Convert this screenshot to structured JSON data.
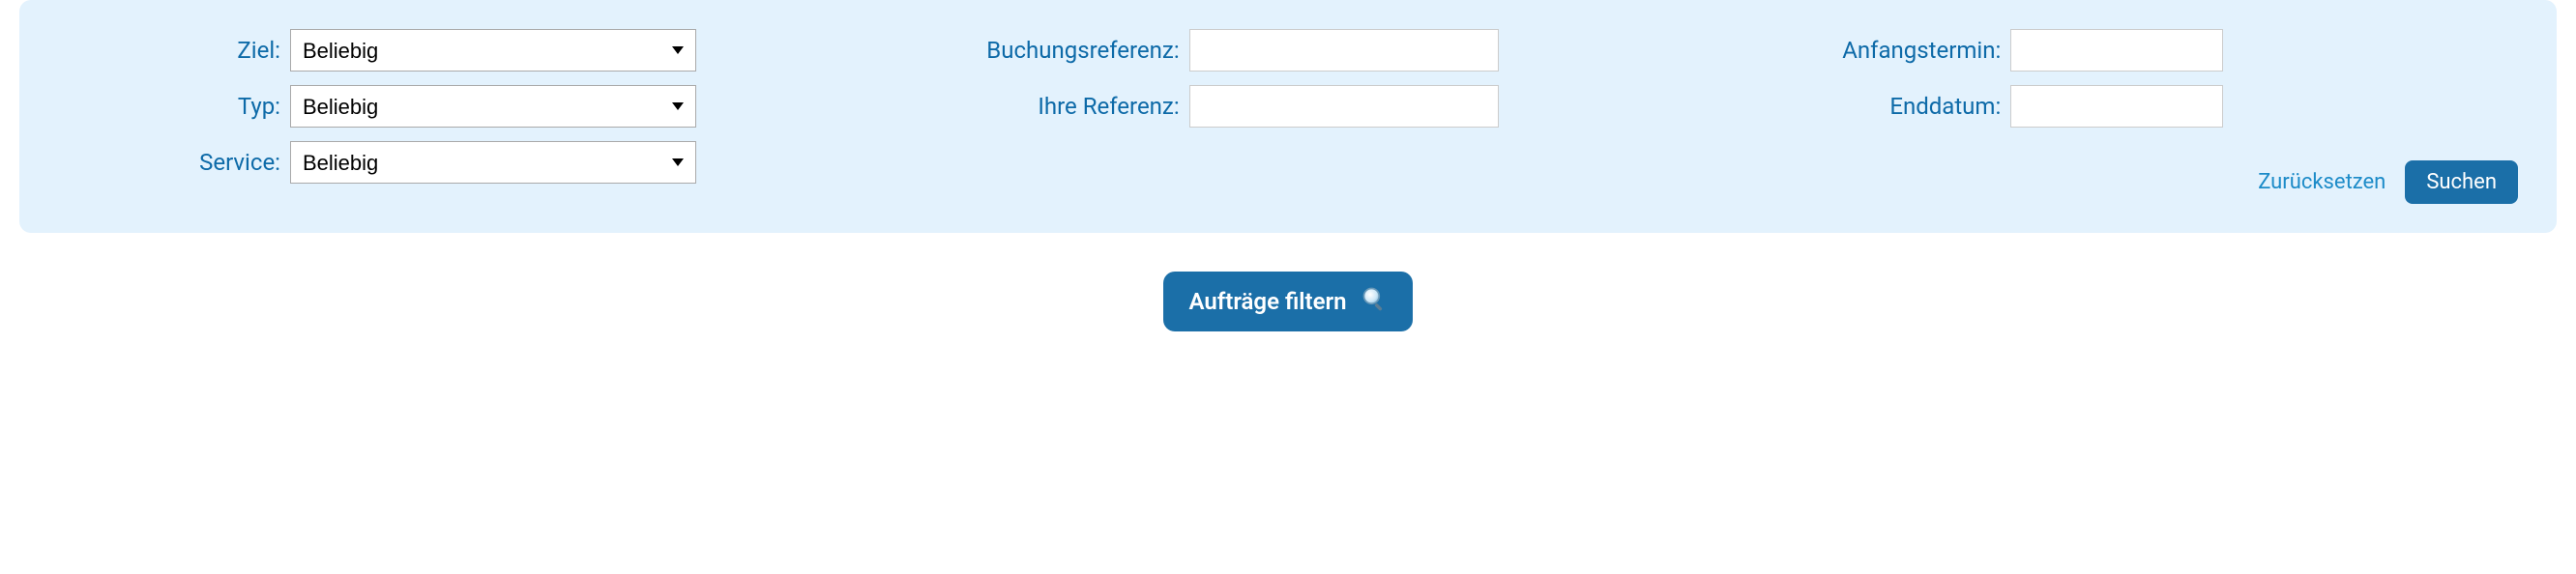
{
  "panel": {
    "col1": {
      "ziel": {
        "label": "Ziel:",
        "value": "Beliebig"
      },
      "typ": {
        "label": "Typ:",
        "value": "Beliebig"
      },
      "service": {
        "label": "Service:",
        "value": "Beliebig"
      }
    },
    "col2": {
      "buchungsreferenz": {
        "label": "Buchungsreferenz:",
        "value": ""
      },
      "ihreReferenz": {
        "label": "Ihre Referenz:",
        "value": ""
      }
    },
    "col3": {
      "anfangstermin": {
        "label": "Anfangstermin:",
        "value": ""
      },
      "enddatum": {
        "label": "Enddatum:",
        "value": ""
      },
      "reset": "Zurücksetzen",
      "search": "Suchen"
    }
  },
  "bottom": {
    "filterButton": "Aufträge filtern"
  }
}
